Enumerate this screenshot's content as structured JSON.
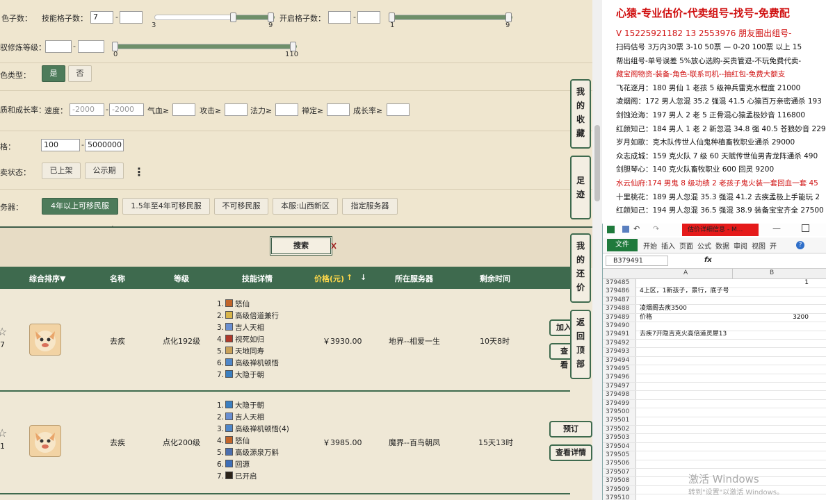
{
  "filters": {
    "skill_slots_label": "技能格子数：",
    "skill_slots_min": "7",
    "skill_slots_max": "",
    "skill_slider_low": "3",
    "skill_slider_high": "9",
    "open_slots_label": "开启格子数：",
    "open_slots_min": "",
    "open_slots_max": "",
    "open_slider_low": "1",
    "open_slider_high": "9",
    "cultivation_label": "驭修炼等级：",
    "cultivation_slider_low": "0",
    "cultivation_slider_high": "110",
    "rare_label": "色类型：",
    "rare_yes": "是",
    "rare_no": "否",
    "growth_label": "质和成长率：",
    "speed_label": "速度：",
    "speed_min_ph": "-2000",
    "speed_max_ph": "-2000",
    "hp_label": "气血≥",
    "atk_label": "攻击≥",
    "mp_label": "法力≥",
    "zen_label": "禅定≥",
    "growth_rate_label": "成长率≥",
    "price_label": "格：",
    "price_min": "100",
    "price_max": "5000000",
    "status_label": "卖状态：",
    "status_listed": "已上架",
    "status_public": "公示期",
    "more_icon": "⋮",
    "server_label": "务器：",
    "server_options": [
      "4年以上可移民服",
      "1.5年至4年可移民服",
      "不可移民服",
      "本服:山西新区",
      "指定服务器"
    ],
    "search_label": "搜索"
  },
  "table": {
    "headers": {
      "sort": "综合排序▼",
      "name": "名称",
      "level": "等级",
      "skills": "技能详情",
      "price": "价格(元)",
      "server": "所在服务器",
      "time": "剩余时间"
    },
    "rows": [
      {
        "count": "7",
        "name": "去疾",
        "level": "点化192级",
        "price": "￥3930.00",
        "server": "地界--相爱一生",
        "time": "10天8时",
        "skills": [
          {
            "n": "1.",
            "t": "怒仙",
            "c": "#c2652a"
          },
          {
            "n": "2.",
            "t": "高级倍道兼行",
            "c": "#d8b54a"
          },
          {
            "n": "3.",
            "t": "吉人天相",
            "c": "#6a8fd0"
          },
          {
            "n": "4.",
            "t": "视死如归",
            "c": "#b03a2a"
          },
          {
            "n": "5.",
            "t": "天地同寿",
            "c": "#caa25a"
          },
          {
            "n": "6.",
            "t": "高级禅机顿悟",
            "c": "#4f87c9"
          },
          {
            "n": "7.",
            "t": "大隐于朝",
            "c": "#3b7fc0"
          }
        ],
        "btn1": "加入",
        "btn2": "查看"
      },
      {
        "count": "1",
        "name": "去疾",
        "level": "点化200级",
        "price": "￥3985.00",
        "server": "魔界--百鸟朝凤",
        "time": "15天13时",
        "skills": [
          {
            "n": "1.",
            "t": "大隐于朝",
            "c": "#3b7fc0"
          },
          {
            "n": "2.",
            "t": "吉人天相",
            "c": "#6a8fd0"
          },
          {
            "n": "3.",
            "t": "高级禅机顿悟(4)",
            "c": "#4f87c9"
          },
          {
            "n": "4.",
            "t": "怒仙",
            "c": "#c2652a"
          },
          {
            "n": "5.",
            "t": "高级源泉万斛",
            "c": "#4c6fae"
          },
          {
            "n": "6.",
            "t": "回源",
            "c": "#3e6fb8"
          },
          {
            "n": "7.",
            "t": "已开启",
            "c": "#2a2218"
          }
        ],
        "btn1": "预订",
        "btn2": "查看详情"
      }
    ]
  },
  "side_tabs": [
    {
      "name": "favorites",
      "chars": [
        "我",
        "的",
        "收",
        "藏"
      ]
    },
    {
      "name": "footprint",
      "chars": [
        "足",
        "迹"
      ]
    },
    {
      "name": "my-offer",
      "chars": [
        "我",
        "的",
        "还",
        "价"
      ]
    },
    {
      "name": "back-top",
      "chars": [
        "返",
        "回",
        "顶",
        "部"
      ]
    }
  ],
  "ad": {
    "title": "心猿-专业估价-代卖组号-找号-免费配",
    "contact": "V 15225921182   13 2553976 朋友圈出组号-",
    "lines": [
      {
        "t": "扫码估号 3万内30票 3-10 50票 — 0-20 100票 以上 15",
        "c": "#111"
      },
      {
        "t": "帮出组号-单号误差 5%放心选购-买贵管退-不玩免费代卖-",
        "c": "#111"
      },
      {
        "t": "藏宝阁物资-装备-角色-联系司机--抽红包-免费大额支",
        "c": "#d01010"
      },
      {
        "t": "飞花逐月：180 男仙 1 老孩 5 级神兵雷克水程度 21000",
        "c": "#111"
      },
      {
        "t": "凌烟阁：172 男人忽混 35.2 强混 41.5 心猿百万亲密通杀 193",
        "c": "#111"
      },
      {
        "t": "剑蚀沧海：197 男人 2 老 5 正骨混心猿孟极妙音 116800",
        "c": "#111"
      },
      {
        "t": "红颜知己：184 男人 1 老 2 新忽混 34.8 强 40.5 苍狼妙音 229",
        "c": "#111"
      },
      {
        "t": "岁月如歌：克木队传世人仙鬼种植畜牧职业通杀 29000",
        "c": "#111"
      },
      {
        "t": "众志成城：159 克火队 7 级 60 天赋传世仙男青龙阵通杀 490",
        "c": "#111"
      },
      {
        "t": "剑胆琴心：140 克火队畜牧职业 600 回灵 9200",
        "c": "#111"
      },
      {
        "t": "水云仙府:174 男鬼 8 级功绩 2 老孩子鬼火装一套回血一套 45",
        "c": "#d01010"
      },
      {
        "t": "十里桃花：189 男人忽混 35.3 强混 41.2 去疾孟极上手能玩 2",
        "c": "#111"
      },
      {
        "t": "红颜知己：194 男人忽混 36.5 强混 38.9 装备宝宝齐全 27500",
        "c": "#111"
      }
    ]
  },
  "excel": {
    "title": "估价详细信息 - M...",
    "ribbon_tabs": [
      "文件",
      "开始",
      "插入",
      "页面",
      "公式",
      "数据",
      "审阅",
      "视图",
      "开"
    ],
    "cell_ref": "B379491",
    "fx": "fx",
    "col_a": "A",
    "col_b": "B",
    "rows": [
      {
        "r": "379485",
        "a": "",
        "b": "1"
      },
      {
        "r": "379486",
        "a": "4上区，1新孩子，景行，底子号",
        "b": ""
      },
      {
        "r": "379487",
        "a": "",
        "b": ""
      },
      {
        "r": "379488",
        "a": "凌烟阁去疾3500",
        "b": ""
      },
      {
        "r": "379489",
        "a": "价格",
        "b": "3200"
      },
      {
        "r": "379490",
        "a": "",
        "b": ""
      },
      {
        "r": "379491",
        "a": "去疾7开隐吉克火高倍道灵犀13",
        "b": ""
      },
      {
        "r": "379492",
        "a": "",
        "b": ""
      },
      {
        "r": "379493",
        "a": "",
        "b": ""
      },
      {
        "r": "379494",
        "a": "",
        "b": ""
      },
      {
        "r": "379495",
        "a": "",
        "b": ""
      },
      {
        "r": "379496",
        "a": "",
        "b": ""
      },
      {
        "r": "379497",
        "a": "",
        "b": ""
      },
      {
        "r": "379498",
        "a": "",
        "b": ""
      },
      {
        "r": "379499",
        "a": "",
        "b": ""
      },
      {
        "r": "379500",
        "a": "",
        "b": ""
      },
      {
        "r": "379501",
        "a": "",
        "b": ""
      },
      {
        "r": "379502",
        "a": "",
        "b": ""
      },
      {
        "r": "379503",
        "a": "",
        "b": ""
      },
      {
        "r": "379504",
        "a": "",
        "b": ""
      },
      {
        "r": "379505",
        "a": "",
        "b": ""
      },
      {
        "r": "379506",
        "a": "",
        "b": ""
      },
      {
        "r": "379507",
        "a": "",
        "b": ""
      },
      {
        "r": "379508",
        "a": "",
        "b": ""
      },
      {
        "r": "379509",
        "a": "",
        "b": ""
      },
      {
        "r": "379510",
        "a": "",
        "b": ""
      }
    ]
  },
  "watermark": {
    "line1": "激活 Windows",
    "line2": "转到\"设置\"以激活 Windows。"
  },
  "colors": {
    "accent_green": "#3e6a4e",
    "active_button": "#4d7b5a",
    "price_header": "#ffd84a",
    "ad_red": "#d01010"
  }
}
